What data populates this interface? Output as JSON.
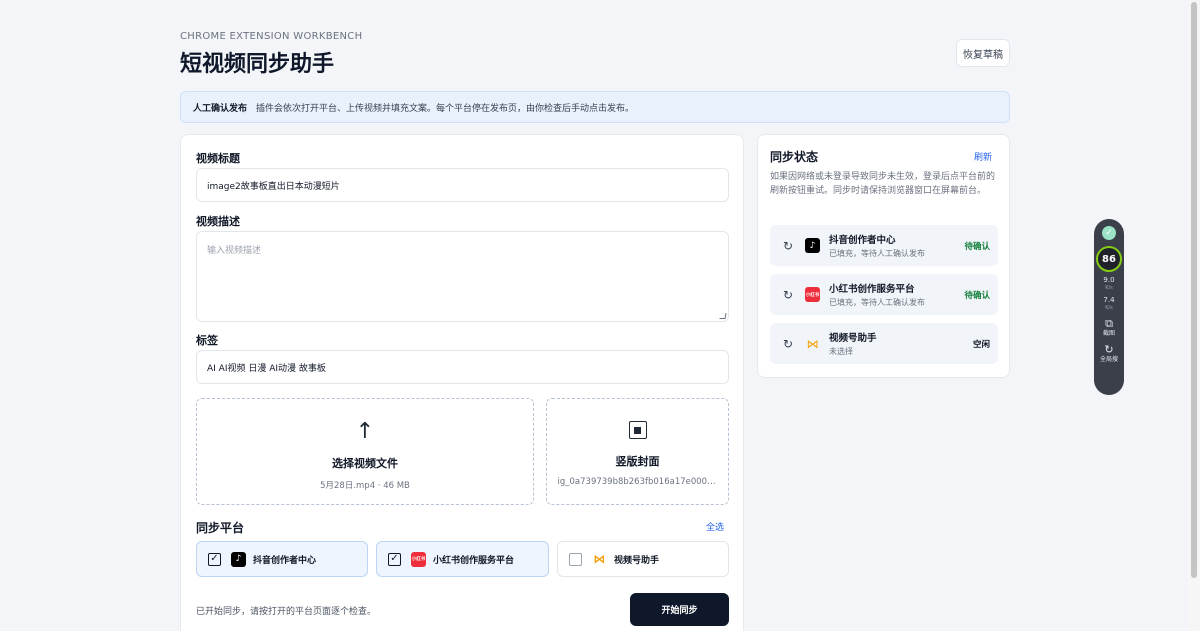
{
  "header": {
    "eyebrow": "CHROME EXTENSION WORKBENCH",
    "title": "短视频同步助手",
    "restore_label": "恢复草稿"
  },
  "notice": {
    "label": "人工确认发布",
    "text": "插件会依次打开平台、上传视频并填充文案。每个平台停在发布页，由你检查后手动点击发布。"
  },
  "form": {
    "title_label": "视频标题",
    "title_value": "image2故事板直出日本动漫短片",
    "desc_label": "视频描述",
    "desc_placeholder": "输入视频描述",
    "tags_label": "标签",
    "tags_value": "AI AI视频 日漫 AI动漫 故事板",
    "video_upload": {
      "icon": "upload-arrow-icon",
      "title": "选择视频文件",
      "file": "5月28日.mp4 · 46 MB"
    },
    "cover_upload": {
      "icon": "cover-image-icon",
      "title": "竖版封面",
      "file": "ig_0a739739b8b263fb016a17e0002..."
    },
    "platforms_title": "同步平台",
    "select_all": "全选",
    "platforms": [
      {
        "name": "抖音创作者中心",
        "checked": true,
        "icon": "douyin-icon"
      },
      {
        "name": "小红书创作服务平台",
        "checked": true,
        "icon": "xiaohongshu-icon",
        "icon_text": "小红书"
      },
      {
        "name": "视频号助手",
        "checked": false,
        "icon": "wechat-channels-icon"
      }
    ],
    "footer_status": "已开始同步，请按打开的平台页面逐个检查。",
    "start_label": "开始同步"
  },
  "status": {
    "title": "同步状态",
    "refresh_label": "刷新",
    "description": "如果因网络或未登录导致同步未生效，登录后点平台前的刷新按钮重试。同步时请保持浏览器窗口在屏幕前台。",
    "items": [
      {
        "name": "抖音创作者中心",
        "sub": "已填充，等待人工确认发布",
        "state": "待确认",
        "icon": "douyin-icon"
      },
      {
        "name": "小红书创作服务平台",
        "sub": "已填充，等待人工确认发布",
        "state": "待确认",
        "icon": "xiaohongshu-icon",
        "icon_text": "小红书"
      },
      {
        "name": "视频号助手",
        "sub": "未选择",
        "state": "空闲",
        "icon": "wechat-channels-icon"
      }
    ]
  },
  "widget": {
    "score": "86",
    "up_speed": "9.0",
    "up_unit": "K/s",
    "down_speed": "7.4",
    "down_unit": "K/s",
    "screenshot_label": "截图",
    "search_label": "全局搜"
  },
  "colors": {
    "accent": "#2563eb",
    "primary_button": "#0f172a",
    "pending": "#15803d",
    "notice_bg": "#e9f1fd",
    "selected_bg": "#eef5fe"
  }
}
